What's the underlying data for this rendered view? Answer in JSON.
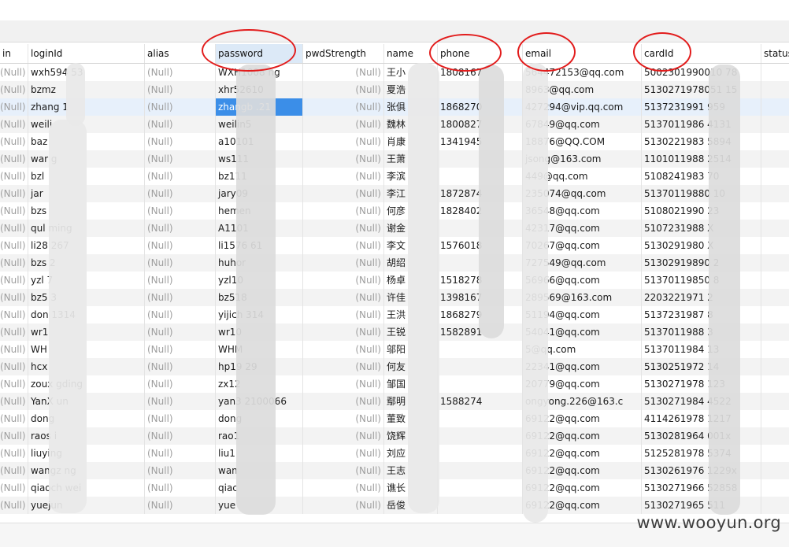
{
  "columns": [
    "in",
    "loginId",
    "alias",
    "password",
    "pwdStrength",
    "name",
    "phone",
    "email",
    "cardId",
    "status"
  ],
  "null_text": "(Null)",
  "rows": [
    {
      "loginId": "wxh594     53",
      "password": "WXH1008      ng",
      "name": "王小",
      "phone": "1808167",
      "email": "564472153@qq.com",
      "cardId": "5002301990010     78"
    },
    {
      "loginId": "bzmz",
      "password": "xhr52610",
      "name": "夏浩",
      "phone": "",
      "email": "8963@qq.com",
      "cardId": "5130271978051     15"
    },
    {
      "loginId": "zhang      1",
      "password": "zhangb      .21",
      "name": "张俱",
      "phone": "1868270",
      "email": "427294@vip.qq.com",
      "cardId": "5137231991     959"
    },
    {
      "loginId": "weili",
      "password": "weilin5",
      "name": "魏林",
      "phone": "1800827",
      "email": "67849@qq.com",
      "cardId": "5137011986     4131"
    },
    {
      "loginId": "baz",
      "password": "a10101",
      "name": "肖康",
      "phone": "1341945",
      "email": "18876@QQ.COM",
      "cardId": "5130221983     5894"
    },
    {
      "loginId": "war      g",
      "password": "ws111",
      "name": "王萧",
      "phone": "",
      "email": "jsong@163.com",
      "cardId": "1101011988     2514"
    },
    {
      "loginId": "bzl",
      "password": "bz111",
      "name": "李滨",
      "phone": "",
      "email": "449@qq.com",
      "cardId": "5108241983     70"
    },
    {
      "loginId": "jar",
      "password": "jary09",
      "name": "李江",
      "phone": "1872874",
      "email": "235074@qq.com",
      "cardId": "51370119880     10"
    },
    {
      "loginId": "bzs",
      "password": "hemen",
      "name": "何彦",
      "phone": "1828402",
      "email": "36548@qq.com",
      "cardId": "5108021990     23"
    },
    {
      "loginId": "qul      ming",
      "password": "A1101",
      "name": "谢金",
      "phone": "",
      "email": "42317@qq.com",
      "cardId": "5107231988     X"
    },
    {
      "loginId": "li28      267",
      "password": "li1576      61",
      "name": "李文",
      "phone": "1576018",
      "email": "70267@qq.com",
      "cardId": "5130291980     X"
    },
    {
      "loginId": "bzs      2",
      "password": "huhor",
      "name": "胡绍",
      "phone": "",
      "email": "727549@qq.com",
      "cardId": "51302919890     2"
    },
    {
      "loginId": "yzl      7",
      "password": "yzl10",
      "name": "杨卓",
      "phone": "1518278",
      "email": "56966@qq.com",
      "cardId": "51370119850     8"
    },
    {
      "loginId": "bz5      3",
      "password": "bz518",
      "name": "许佳",
      "phone": "1398167",
      "email": "289569@163.com",
      "cardId": "2203221971     2"
    },
    {
      "loginId": "don      1314",
      "password": "yijich      314",
      "name": "王洪",
      "phone": "1868279",
      "email": "51194@qq.com",
      "cardId": "5137231987     8"
    },
    {
      "loginId": "wr1",
      "password": "wr10",
      "name": "王锐",
      "phone": "1582891",
      "email": "54041@qq.com",
      "cardId": "5137011988     3"
    },
    {
      "loginId": "WH",
      "password": "WHM",
      "name": "邬阳",
      "phone": "",
      "email": "5@qq.com",
      "cardId": "5137011984     13"
    },
    {
      "loginId": "hcx",
      "password": "hp19      29",
      "name": "何友",
      "phone": "",
      "email": "22341@qq.com",
      "cardId": "5130251972     14"
    },
    {
      "loginId": "zoux      gding",
      "password": "zx12",
      "name": "邹国",
      "phone": "",
      "email": "20779@qq.com",
      "cardId": "5130271978     123"
    },
    {
      "loginId": "YanX      un",
      "password": "yan3      2100066",
      "name": "鄢明",
      "phone": "1588274",
      "email": "ongyong.226@163.c",
      "cardId": "5130271984     4522"
    },
    {
      "loginId": "dong",
      "password": "dong",
      "name": "董致",
      "phone": "",
      "email": "69122@qq.com",
      "cardId": "4114261978     1217"
    },
    {
      "loginId": "raos      i",
      "password": "rao1",
      "name": "饶辉",
      "phone": "",
      "email": "69122@qq.com",
      "cardId": "5130281964     001x"
    },
    {
      "loginId": "liuying",
      "password": "liu1",
      "name": "刘应",
      "phone": "",
      "email": "69122@qq.com",
      "cardId": "5125281978     5374"
    },
    {
      "loginId": "wangz      ng",
      "password": "wan",
      "name": "王志",
      "phone": "",
      "email": "69122@qq.com",
      "cardId": "5130261976     1229x"
    },
    {
      "loginId": "qiaoch      wei",
      "password": "qiac",
      "name": "谯长",
      "phone": "",
      "email": "69122@qq.com",
      "cardId": "5130271966     52858"
    },
    {
      "loginId": "yuejun",
      "password": "yue",
      "name": "岳俊",
      "phone": "",
      "email": "69122@qq.com",
      "cardId": "5130271965     511"
    }
  ],
  "selected_row": 2,
  "selected_column": "password",
  "watermark": "www.wooyun.org",
  "colors": {
    "highlight_circle": "#e21c1c",
    "cell_selection": "#3b8ee8",
    "null_text": "#9e9e9e"
  }
}
